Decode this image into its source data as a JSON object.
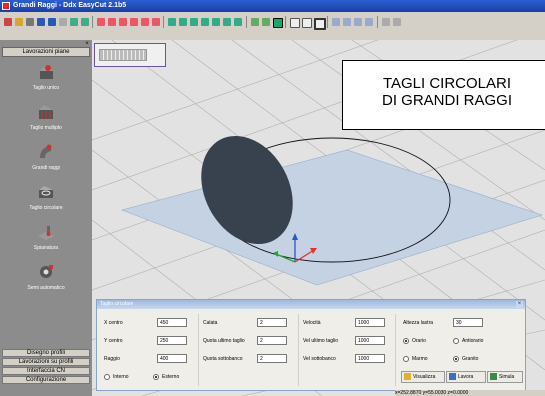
{
  "window": {
    "title": "Grandi Raggi - Ddx EasyCut 2.1b5"
  },
  "sidebar": {
    "header": "Lavorazioni piane",
    "items": [
      {
        "label": "Taglio unico",
        "icon": "single-cut-icon"
      },
      {
        "label": "Taglio multiplo",
        "icon": "multiple-cut-icon"
      },
      {
        "label": "Grandi raggi",
        "icon": "large-radius-icon"
      },
      {
        "label": "Taglio circolare",
        "icon": "circular-cut-icon"
      },
      {
        "label": "Spianatura",
        "icon": "surfacing-icon"
      },
      {
        "label": "Semi automatico",
        "icon": "semi-automatic-icon"
      }
    ],
    "bottom_items": [
      "Disegno profili",
      "Lavorazioni su profili",
      "Interfaccia CN",
      "Configurazione"
    ]
  },
  "banner": {
    "line1": "TAGLI CIRCOLARI",
    "line2": "DI GRANDI RAGGI"
  },
  "panel": {
    "title": "Taglio circolare",
    "x_centro_label": "X centro",
    "x_centro": "450",
    "y_centro_label": "Y centro",
    "y_centro": "250",
    "raggio_label": "Raggio",
    "raggio": "400",
    "interno_label": "Interno",
    "esterno_label": "Esterno",
    "calata_label": "Calata",
    "calata": "2",
    "quota_ultimo_label": "Quota ultimo taglio",
    "quota_ultimo": "2",
    "quota_sotto_label": "Quota sottobanco",
    "quota_sotto": "2",
    "velocita_label": "Velocità",
    "velocita": "1000",
    "vel_ultimo_label": "Vel ultimo taglio",
    "vel_ultimo": "1000",
    "vel_sotto_label": "Vel sottobanco",
    "vel_sotto": "1000",
    "altezza_label": "Altezza lastra",
    "altezza": "30",
    "orario_label": "Orario",
    "antiorario_label": "Antiorario",
    "marmo_label": "Marmo",
    "granito_label": "Granito",
    "visualizza": "Visualizza",
    "lavora": "Lavora",
    "simula": "Simula"
  },
  "status": {
    "coords": "x=252.8870  y=55.0030  z=0.0000"
  }
}
